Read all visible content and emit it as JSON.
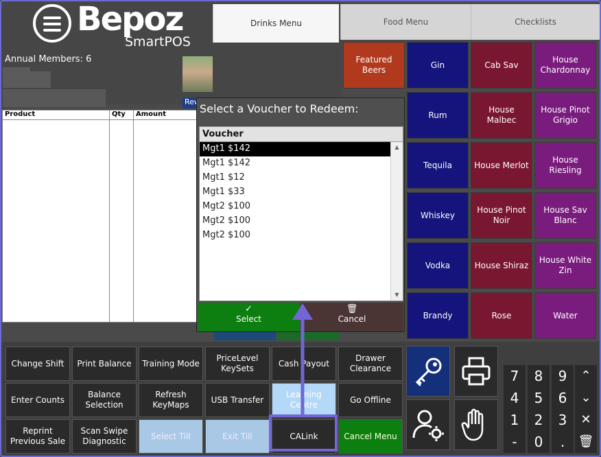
{
  "brand": {
    "name": "Bepoz",
    "sub": "SmartPOS"
  },
  "customer": {
    "members_label": "Annual Members: 6",
    "reward_label": "Rew"
  },
  "tabs": [
    {
      "label": "Drinks Menu",
      "active": true
    },
    {
      "label": "Food Menu",
      "active": false
    },
    {
      "label": "Checklists",
      "active": false
    }
  ],
  "product_grid": [
    {
      "label": "Featured Beers",
      "color": "#b13a1e"
    },
    {
      "label": "Gin",
      "color": "#14147c"
    },
    {
      "label": "Cab Sav",
      "color": "#7a1730"
    },
    {
      "label": "House Chardonnay",
      "color": "#7a1c7e"
    },
    {
      "label": "Rum",
      "color": "#14147c"
    },
    {
      "label": "House Malbec",
      "color": "#7a1730"
    },
    {
      "label": "House Pinot Grigio",
      "color": "#7a1c7e"
    },
    {
      "label": "Tequila",
      "color": "#14147c"
    },
    {
      "label": "House Merlot",
      "color": "#7a1730"
    },
    {
      "label": "House Riesling",
      "color": "#7a1c7e"
    },
    {
      "label": "Whiskey",
      "color": "#14147c"
    },
    {
      "label": "House Pinot Noir",
      "color": "#7a1730"
    },
    {
      "label": "House Sav Blanc",
      "color": "#7a1c7e"
    },
    {
      "label": "Vodka",
      "color": "#14147c"
    },
    {
      "label": "House Shiraz",
      "color": "#7a1730"
    },
    {
      "label": "House White Zin",
      "color": "#7a1c7e"
    },
    {
      "label": "Brandy",
      "color": "#14147c"
    },
    {
      "label": "Rose",
      "color": "#7a1730"
    },
    {
      "label": "Water",
      "color": "#7a1c7e"
    }
  ],
  "product_table": {
    "columns": [
      "Product",
      "Qty",
      "Amount"
    ]
  },
  "dialog": {
    "title": "Select a Voucher to Redeem:",
    "header": "Voucher",
    "rows": [
      "Mgt1 $142",
      "Mgt1 $142",
      "Mgt1 $12",
      "Mgt1 $33",
      "Mgt2 $100",
      "Mgt2 $100",
      "Mgt2 $100"
    ],
    "selected_index": 0,
    "select_label": "Select",
    "cancel_label": "Cancel"
  },
  "function_buttons": [
    {
      "label": "Change Shift",
      "style": "dark"
    },
    {
      "label": "Print Balance",
      "style": "dark"
    },
    {
      "label": "Training Mode",
      "style": "dark"
    },
    {
      "label": "PriceLevel KeySets",
      "style": "dark"
    },
    {
      "label": "Cash Payout",
      "style": "dark"
    },
    {
      "label": "Drawer Clearance",
      "style": "dark"
    },
    {
      "label": "Enter Counts",
      "style": "dark"
    },
    {
      "label": "Balance Selection",
      "style": "dark"
    },
    {
      "label": "Refresh KeyMaps",
      "style": "dark"
    },
    {
      "label": "USB Transfer",
      "style": "dark"
    },
    {
      "label": "Learning Centre",
      "style": "lightblue"
    },
    {
      "label": "Go Offline",
      "style": "dark"
    },
    {
      "label": "Reprint Previous Sale",
      "style": "dark"
    },
    {
      "label": "Scan Swipe Diagnostic",
      "style": "dark"
    },
    {
      "label": "Select Till",
      "style": "light"
    },
    {
      "label": "Exit Till",
      "style": "light"
    },
    {
      "label": "CALink",
      "style": "dark"
    },
    {
      "label": "Cancel Menu",
      "style": "green"
    }
  ],
  "icons": [
    "key-icon",
    "printer-icon",
    "user-settings-icon",
    "hand-icon"
  ],
  "numpad": [
    "7",
    "8",
    "9",
    "4",
    "5",
    "6",
    "1",
    "2",
    "3",
    "-",
    "0",
    "."
  ],
  "accent_colors": {
    "highlight": "#7266d6",
    "select_green": "#0c7f10",
    "cancel_brown": "#4a3434"
  }
}
